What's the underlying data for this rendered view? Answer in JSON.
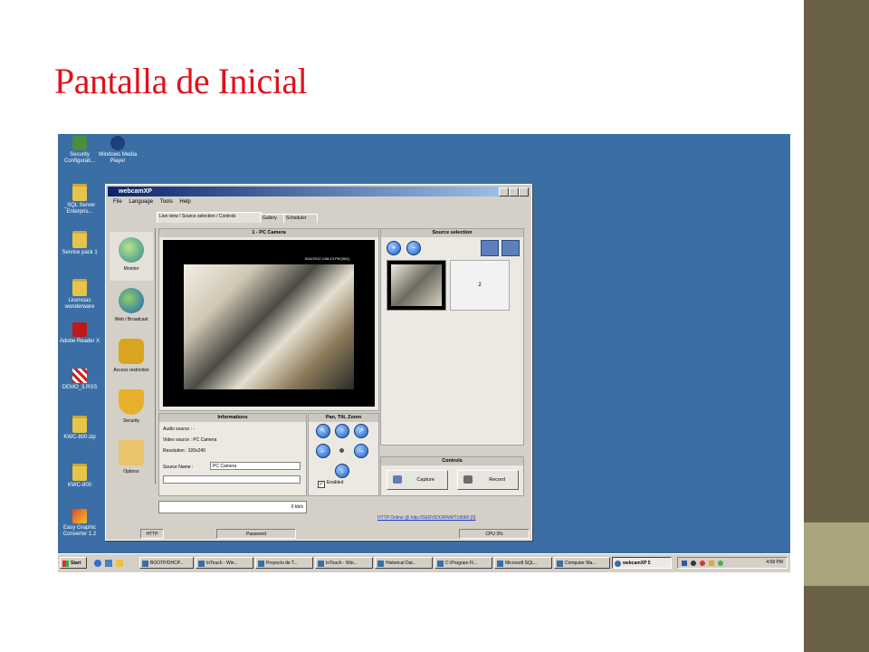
{
  "slide": {
    "title": "Pantalla de Inicial",
    "title_color": "#e0121b",
    "accent_color": "#6b6149",
    "accent_light": "#a9a47b"
  },
  "desktop": {
    "background_color": "#3a6ea5",
    "icons": [
      {
        "label": "Security Configurati...",
        "icon": "security-icon"
      },
      {
        "label": "Windows Media Player",
        "icon": "media-player-icon"
      },
      {
        "label": "_SQL Server Enterpris...",
        "icon": "folder-icon"
      },
      {
        "label": "Service pack 1",
        "icon": "folder-icon"
      },
      {
        "label": "Licencias wonderware",
        "icon": "folder-icon"
      },
      {
        "label": "Adobe Reader X",
        "icon": "pdf-icon"
      },
      {
        "label": "DEMO_3.RSS",
        "icon": "file-icon"
      },
      {
        "label": "KWC-800.zip",
        "icon": "zip-icon"
      },
      {
        "label": "KWC-800",
        "icon": "folder-icon"
      },
      {
        "label": "Easy Graphic Converter 1.2",
        "icon": "converter-icon"
      }
    ]
  },
  "window": {
    "title": "webcamXP",
    "controls": {
      "header": "Controls",
      "capture_label": "Capture",
      "record_label": "Record"
    },
    "menu": [
      "File",
      "Language",
      "Tools",
      "Help"
    ],
    "tabs": [
      {
        "label": "Live view / Source selection / Controls",
        "active": true
      },
      {
        "label": "Gallery",
        "active": false
      },
      {
        "label": "Scheduler",
        "active": false
      }
    ],
    "nav": [
      {
        "label": "Monitor",
        "icon": "monitor-icon"
      },
      {
        "label": "Web / Broadcast",
        "icon": "globe-icon"
      },
      {
        "label": "Access restriction",
        "icon": "lock-icon"
      },
      {
        "label": "Security",
        "icon": "shield-icon"
      },
      {
        "label": "Options",
        "icon": "options-icon"
      }
    ],
    "camera": {
      "header": "1 - PC Camera",
      "overlay": "5/24/2012 4:58:13 PM  [561]"
    },
    "source_selection": {
      "header": "Source selection",
      "slot2_label": "2"
    },
    "informations": {
      "header": "Informations",
      "audio_source": "Audio source : -",
      "video_source": "Video source : PC Camera",
      "resolution": "Resolution : 320x240",
      "source_name_label": "Source Name :",
      "source_name_value": "PC Camera"
    },
    "ptz": {
      "header": "Pan, Tilt, Zoom",
      "enabled_label": "Enabled"
    },
    "bandwidth": "0 kb/s",
    "http_status": "HTTP Online @ http://SERVIDORWWTI:8080 [0]",
    "statusbar": {
      "http": "HTTP",
      "password": "Password",
      "cpu": "CPU 3%"
    }
  },
  "taskbar": {
    "start_label": "Start",
    "items": [
      {
        "label": "BOOTP/DHCP...",
        "active": false
      },
      {
        "label": "InTouch - Win...",
        "active": false
      },
      {
        "label": "Proyecto de T...",
        "active": false
      },
      {
        "label": "InTouch - Win...",
        "active": false
      },
      {
        "label": "Historical Dat...",
        "active": false
      },
      {
        "label": "C:\\Program Fi...",
        "active": false
      },
      {
        "label": "Microsoft SQL...",
        "active": false
      },
      {
        "label": "Computer Ma...",
        "active": false
      },
      {
        "label": "webcamXP 5",
        "active": true
      }
    ],
    "clock": "4:58 PM"
  }
}
